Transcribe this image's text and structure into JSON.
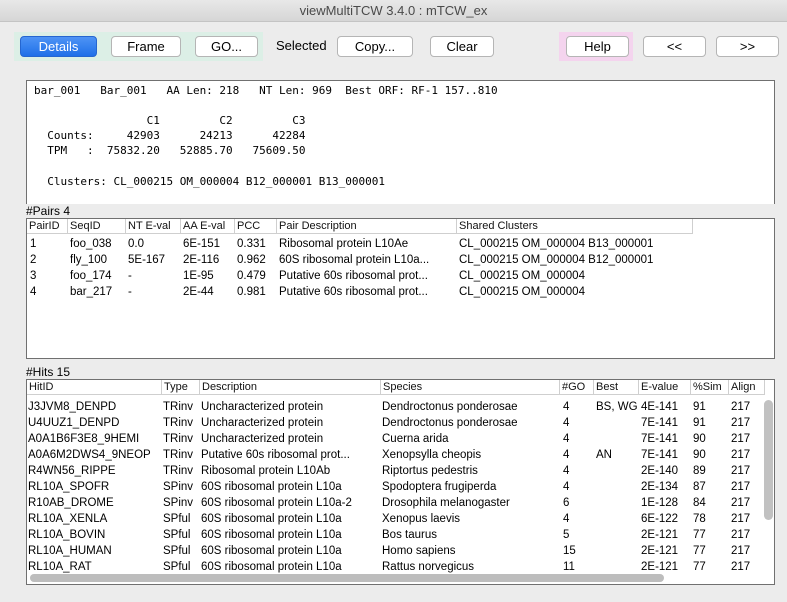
{
  "window": {
    "title": "viewMultiTCW 3.4.0 : mTCW_ex"
  },
  "toolbar": {
    "details": "Details",
    "frame": "Frame",
    "go": "GO...",
    "selected_label": "Selected",
    "copy": "Copy...",
    "clear": "Clear",
    "help": "Help",
    "prev": "<<",
    "next": ">>"
  },
  "info": {
    "line1": "bar_001   Bar_001   AA Len: 218   NT Len: 969  Best ORF: RF-1 157..810",
    "line2": "                 C1         C2         C3",
    "line3": "  Counts:     42903      24213      42284",
    "line4": "  TPM   :  75832.20   52885.70   75609.50",
    "line5": "  Clusters: CL_000215 OM_000004 B12_000001 B13_000001"
  },
  "pairs": {
    "label": "#Pairs 4",
    "columns": [
      "PairID",
      "SeqID",
      "NT E-val",
      "AA E-val",
      "PCC",
      "Pair Description",
      "Shared Clusters"
    ],
    "rows": [
      [
        "1",
        "foo_038",
        "0.0",
        "6E-151",
        "0.331",
        "Ribosomal protein L10Ae",
        "CL_000215 OM_000004 B13_000001"
      ],
      [
        "2",
        "fly_100",
        "5E-167",
        "2E-116",
        "0.962",
        "60S ribosomal protein L10a...",
        "CL_000215 OM_000004 B12_000001"
      ],
      [
        "3",
        "foo_174",
        "-",
        "1E-95",
        "0.479",
        "Putative 60s ribosomal prot...",
        "CL_000215 OM_000004"
      ],
      [
        "4",
        "bar_217",
        "-",
        "2E-44",
        "0.981",
        "Putative 60s ribosomal prot...",
        "CL_000215 OM_000004"
      ]
    ]
  },
  "hits": {
    "label": "#Hits 15",
    "columns": [
      "HitID",
      "Type",
      "Description",
      "Species",
      "#GO",
      "Best",
      "E-value",
      "%Sim",
      "Align"
    ],
    "rows": [
      [
        "J3JVM8_DENPD",
        "TRinv",
        "Uncharacterized protein",
        "Dendroctonus ponderosae",
        "4",
        "BS, WG",
        "4E-141",
        "91",
        "217"
      ],
      [
        "U4UUZ1_DENPD",
        "TRinv",
        "Uncharacterized protein",
        "Dendroctonus ponderosae",
        "4",
        "",
        "7E-141",
        "91",
        "217"
      ],
      [
        "A0A1B6F3E8_9HEMI",
        "TRinv",
        "Uncharacterized protein",
        "Cuerna arida",
        "4",
        "",
        "7E-141",
        "90",
        "217"
      ],
      [
        "A0A6M2DWS4_9NEOP",
        "TRinv",
        "Putative 60s ribosomal prot...",
        "Xenopsylla cheopis",
        "4",
        "AN",
        "7E-141",
        "90",
        "217"
      ],
      [
        "R4WN56_RIPPE",
        "TRinv",
        "Ribosomal protein L10Ab",
        "Riptortus pedestris",
        "4",
        "",
        "2E-140",
        "89",
        "217"
      ],
      [
        "RL10A_SPOFR",
        "SPinv",
        "60S ribosomal protein L10a",
        "Spodoptera frugiperda",
        "4",
        "",
        "2E-134",
        "87",
        "217"
      ],
      [
        "R10AB_DROME",
        "SPinv",
        "60S ribosomal protein L10a-2",
        "Drosophila melanogaster",
        "6",
        "",
        "1E-128",
        "84",
        "217"
      ],
      [
        "RL10A_XENLA",
        "SPful",
        "60S ribosomal protein L10a",
        "Xenopus laevis",
        "4",
        "",
        "6E-122",
        "78",
        "217"
      ],
      [
        "RL10A_BOVIN",
        "SPful",
        "60S ribosomal protein L10a",
        "Bos taurus",
        "5",
        "",
        "2E-121",
        "77",
        "217"
      ],
      [
        "RL10A_HUMAN",
        "SPful",
        "60S ribosomal protein L10a",
        "Homo sapiens",
        "15",
        "",
        "2E-121",
        "77",
        "217"
      ],
      [
        "RL10A_RAT",
        "SPful",
        "60S ribosomal protein L10a",
        "Rattus norvegicus",
        "11",
        "",
        "2E-121",
        "77",
        "217"
      ]
    ]
  }
}
